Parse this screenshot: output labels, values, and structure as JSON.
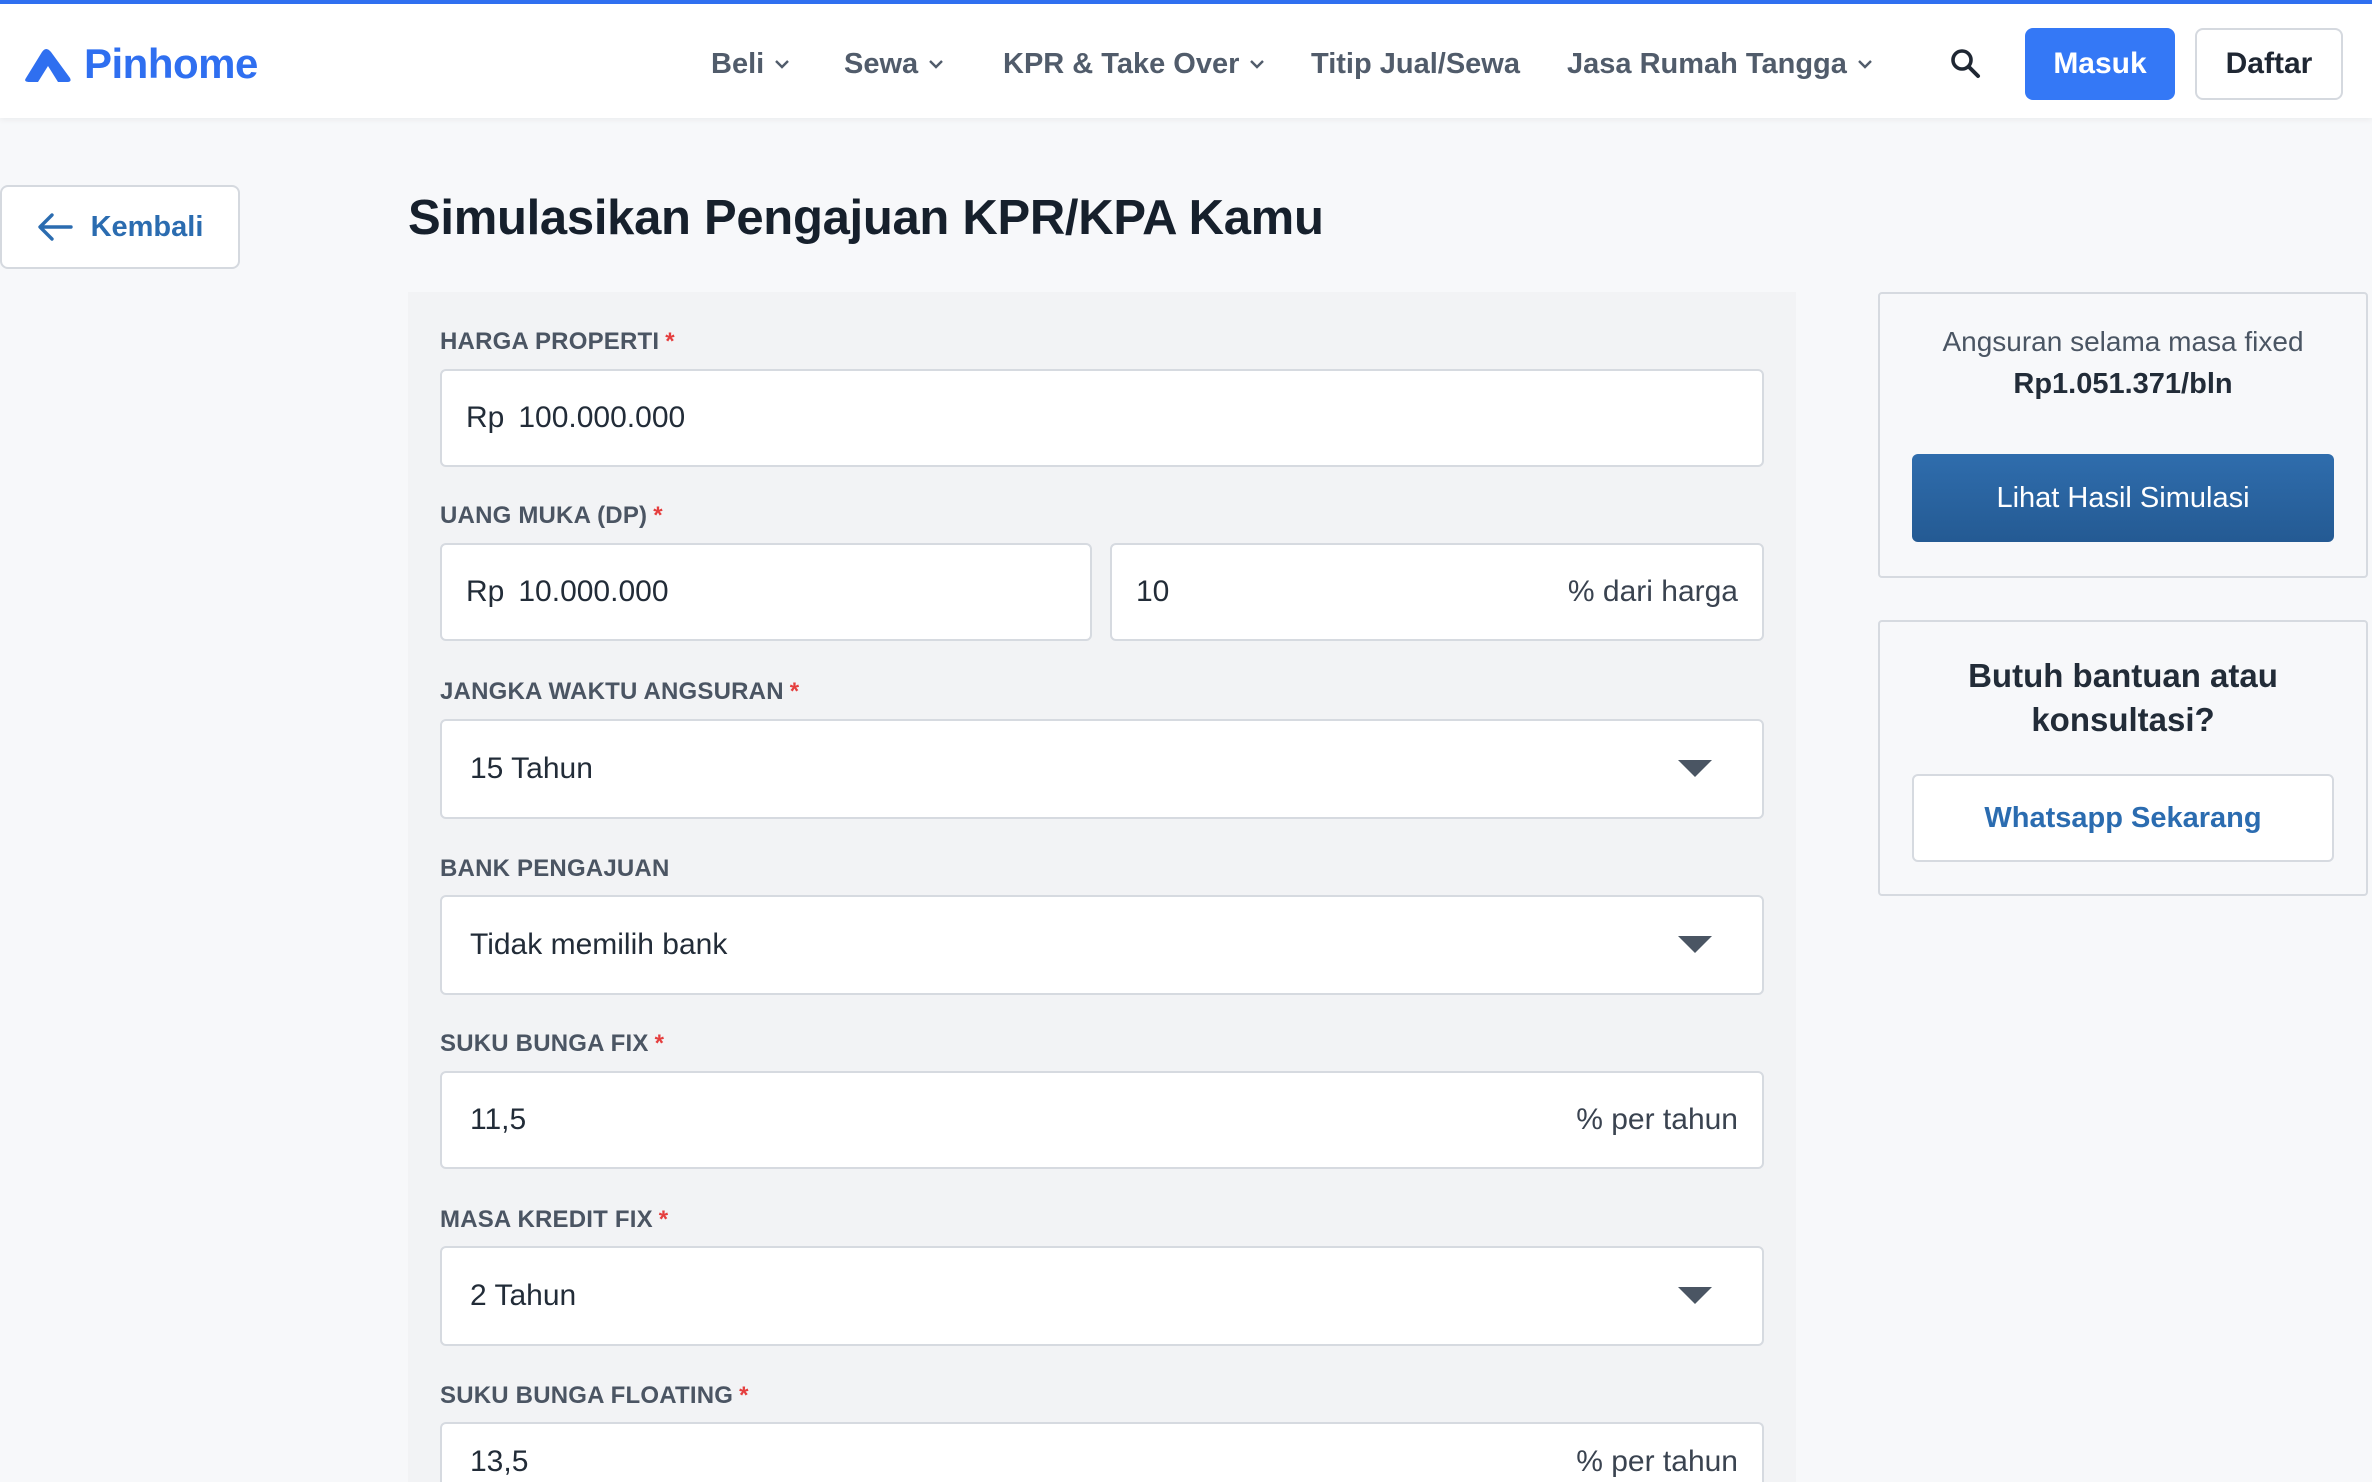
{
  "brand": {
    "name": "Pinhome",
    "color": "#2f6ff0"
  },
  "nav": {
    "items": [
      {
        "label": "Beli",
        "has_dropdown": true
      },
      {
        "label": "Sewa",
        "has_dropdown": true
      },
      {
        "label": "KPR & Take Over",
        "has_dropdown": true
      },
      {
        "label": "Titip Jual/Sewa",
        "has_dropdown": false
      },
      {
        "label": "Jasa Rumah Tangga",
        "has_dropdown": true
      }
    ],
    "search_icon": "search-icon",
    "login_label": "Masuk",
    "register_label": "Daftar"
  },
  "back": {
    "label": "Kembali",
    "icon": "arrow-left-icon"
  },
  "page": {
    "title": "Simulasikan Pengajuan KPR/KPA Kamu"
  },
  "form": {
    "harga_properti": {
      "label": "HARGA PROPERTI",
      "required": "*",
      "prefix": "Rp",
      "value": "100.000.000"
    },
    "uang_muka": {
      "label": "UANG MUKA (DP)",
      "required": "*",
      "prefix": "Rp",
      "value": "10.000.000",
      "percent_value": "10",
      "percent_suffix": "% dari harga"
    },
    "jangka_waktu": {
      "label": "JANGKA WAKTU ANGSURAN",
      "required": "*",
      "value": "15 Tahun"
    },
    "bank": {
      "label": "BANK PENGAJUAN",
      "value": "Tidak memilih bank"
    },
    "suku_bunga_fix": {
      "label": "SUKU BUNGA FIX",
      "required": "*",
      "value": "11,5",
      "suffix": "% per tahun"
    },
    "masa_kredit_fix": {
      "label": "MASA KREDIT FIX",
      "required": "*",
      "value": "2 Tahun"
    },
    "suku_bunga_floating": {
      "label": "SUKU BUNGA FLOATING",
      "required": "*",
      "value": "13,5",
      "suffix": "% per tahun"
    }
  },
  "result": {
    "caption": "Angsuran selama masa fixed",
    "value": "Rp1.051.371/bln",
    "button_label": "Lihat Hasil Simulasi"
  },
  "help": {
    "title_line1": "Butuh bantuan atau",
    "title_line2": "konsultasi?",
    "button_label": "Whatsapp Sekarang"
  },
  "colors": {
    "primary": "#3478f6",
    "link": "#2b6cb0",
    "required": "#e53e3e",
    "result_button": "#2a64a1"
  }
}
